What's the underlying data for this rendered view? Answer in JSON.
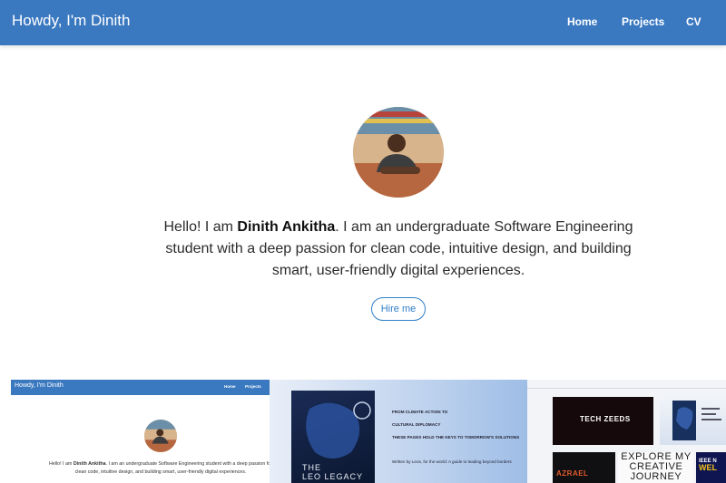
{
  "header": {
    "brand": "Howdy, I'm Dinith"
  },
  "nav": {
    "items": [
      "Home",
      "Projects",
      "CV"
    ]
  },
  "hero": {
    "intro_prefix": "Hello! I am ",
    "name": "Dinith Ankitha",
    "intro_suffix": ". I am an undergraduate Software Engineering student with a deep passion for clean code, intuitive design, and building smart, user-friendly digital experiences.",
    "button": "Hire me"
  },
  "projects": {
    "panel1": {
      "brand": "Howdy, I'm Dinith",
      "nav": [
        "Home",
        "Projects"
      ],
      "intro_prefix": "Hello! I am ",
      "name": "Dinith Ankitha",
      "intro_suffix": ". I am an undergraduate Software Engineering student with a deep passion for clean code, intuitive design, and building smart, user-friendly digital experiences."
    },
    "panel2": {
      "book_title_line1": "THE",
      "book_title_line2": "LEO LEGACY",
      "line1": "FROM CLIMATE ACTION TO",
      "line2": "CULTURAL DIPLOMACY",
      "line3": "THESE PAGES HOLD THE KEYS TO TOMORROW'S SOLUTIONS",
      "line4": "Written by Leos, for the world: A guide to leading beyond borders"
    },
    "panel3": {
      "tech": "TECH ZEEDS",
      "azrael": "AZRAEL",
      "explore": "EXPLORE MY CREATIVE JOURNEY",
      "ieee_line1": "IEEE N",
      "ieee_line2": "WEL"
    }
  },
  "colors": {
    "nav_bg": "#3a78c0",
    "accent": "#2f7fc9"
  }
}
